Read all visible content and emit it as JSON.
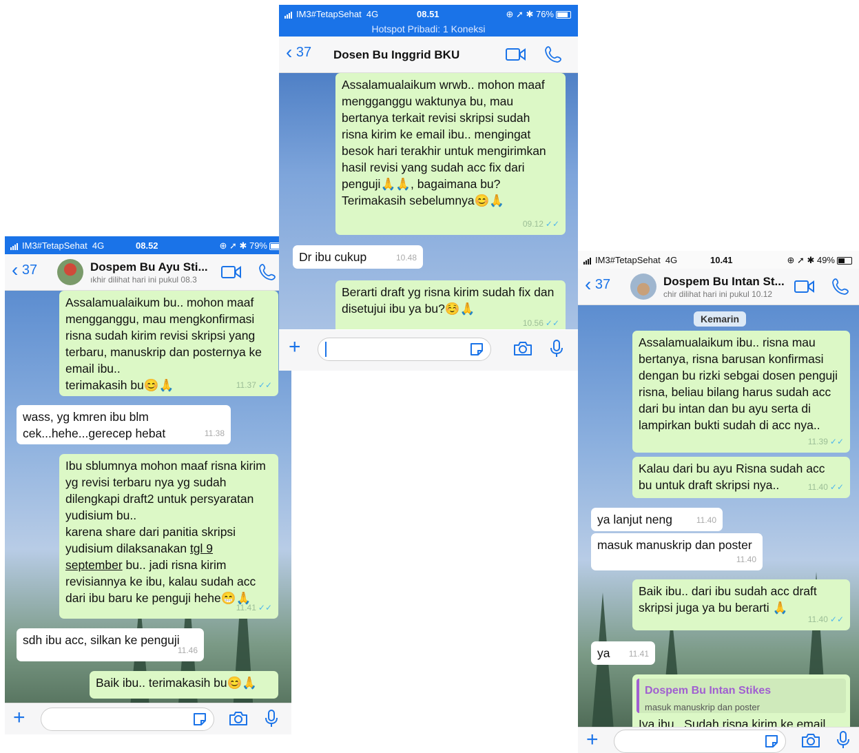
{
  "left": {
    "status": {
      "carrier": "IM3#TetapSehat",
      "network": "4G",
      "time": "08.52",
      "battery": "79%"
    },
    "header": {
      "back_count": "37",
      "contact_name": "Dospem Bu Ayu Sti...",
      "last_seen": "ıkhir dilihat hari ini pukul 08.3"
    },
    "messages": [
      {
        "dir": "out",
        "text": "Assalamualaikum bu.. mohon maaf mengganggu, mau mengkonfirmasi risna sudah kirim revisi skripsi yang terbaru, manuskrip dan posternya ke email ibu..",
        "line2": "terimakasih bu😊🙏",
        "time": "11.37"
      },
      {
        "dir": "in",
        "text": "wass,  yg kmren ibu blm cek...hehe...gerecep hebat",
        "time": "11.38"
      },
      {
        "dir": "out",
        "text": "Ibu sblumnya mohon maaf risna kirim yg revisi terbaru nya yg sudah dilengkapi draft2 untuk persyaratan yudisium bu..",
        "line2a": "karena share dari panitia skripsi yudisium dilaksanakan ",
        "link": "tgl 9 september",
        "line2b": " bu.. jadi risna kirim revisiannya ke ibu, kalau sudah acc dari ibu baru ke penguji hehe😁🙏",
        "time": "11.41"
      },
      {
        "dir": "in",
        "text": "sdh ibu acc, silkan ke penguji",
        "time": "11.46"
      },
      {
        "dir": "out",
        "text": "Baik ibu.. terimakasih bu😊🙏"
      }
    ]
  },
  "middle": {
    "status": {
      "carrier": "IM3#TetapSehat",
      "network": "4G",
      "time": "08.51",
      "battery": "76%",
      "hotspot": "Hotspot Pribadi: 1 Koneksi"
    },
    "header": {
      "back_count": "37",
      "contact_name": "Dosen Bu Inggrid BKU"
    },
    "messages": [
      {
        "dir": "out",
        "text": "Assalamualaikum wrwb.. mohon maaf mengganggu waktunya bu, mau bertanya terkait revisi skripsi sudah risna kirim ke email ibu.. mengingat besok hari terakhir untuk mengirimkan hasil revisi yang sudah acc fix dari penguji🙏🙏, bagaimana bu? Terimakasih sebelumnya😊🙏",
        "time": "09.12"
      },
      {
        "dir": "in",
        "text": "Dr ibu cukup",
        "time": "10.48"
      },
      {
        "dir": "out",
        "text": "Berarti draft yg risna kirim sudah fix dan disetujui ibu ya bu?☺️🙏",
        "time": "10.56"
      }
    ]
  },
  "right": {
    "status": {
      "carrier": "IM3#TetapSehat",
      "network": "4G",
      "time": "10.41",
      "battery": "49%"
    },
    "header": {
      "back_count": "37",
      "contact_name": "Dospem Bu Intan St...",
      "last_seen": "chir dilihat hari ini pukul 10.12"
    },
    "date_chip": "Kemarin",
    "messages": [
      {
        "dir": "out",
        "text": "Assalamualaikum ibu.. risna mau bertanya, risna barusan konfirmasi dengan bu rizki sebgai dosen penguji risna, beliau bilang harus sudah acc dari bu intan dan bu ayu serta di lampirkan bukti sudah di acc nya..",
        "time": "11.39"
      },
      {
        "dir": "out",
        "text": "Kalau dari bu ayu Risna sudah acc bu untuk draft skripsi nya..",
        "time": "11.40"
      },
      {
        "dir": "in",
        "text": "ya lanjut neng",
        "time": "11.40"
      },
      {
        "dir": "in",
        "text": "masuk manuskrip dan poster",
        "time": "11.40"
      },
      {
        "dir": "out",
        "text": "Baik ibu.. dari ibu sudah acc draft skripsi juga ya bu berarti 🙏",
        "time": "11.40"
      },
      {
        "dir": "in",
        "text": "ya",
        "time": "11.41"
      },
      {
        "dir": "out",
        "quote_name": "Dospem Bu Intan Stikes",
        "quote_text": "masuk manuskrip dan poster",
        "text": "Iya ibu.. Sudah risna kirim ke email"
      }
    ]
  },
  "colors": {
    "accent": "#1a73e8",
    "outgoing": "#dcf8c6",
    "incoming": "#ffffff",
    "ticks": "#4fb6ec"
  }
}
